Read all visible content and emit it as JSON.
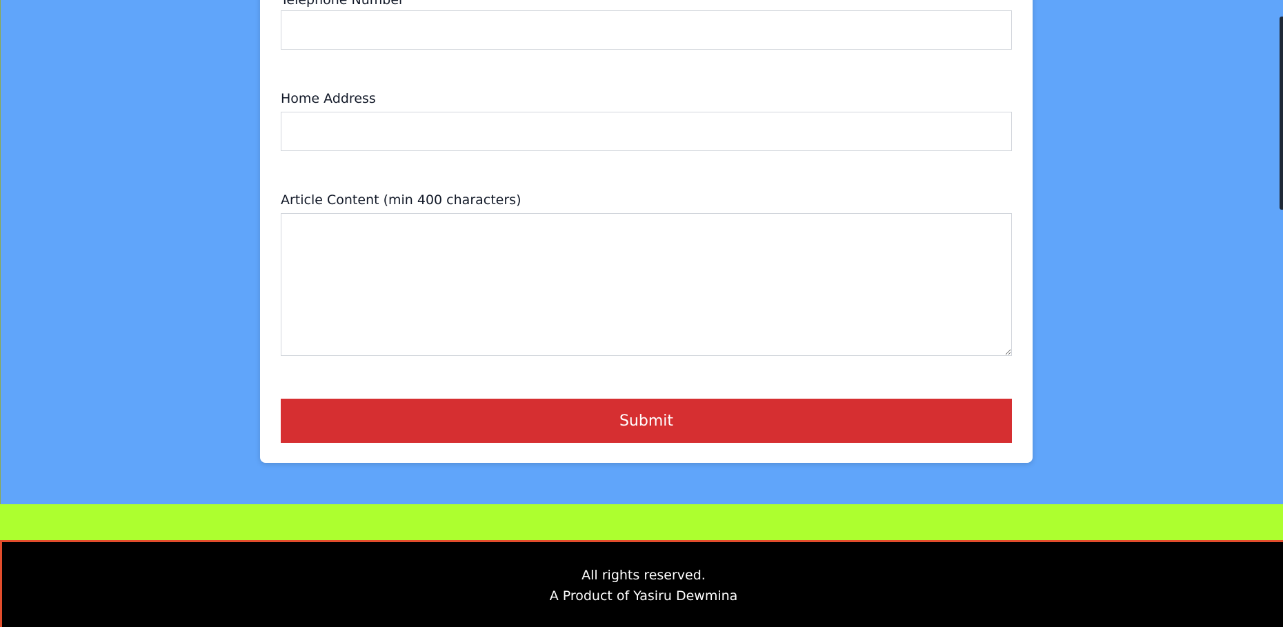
{
  "form": {
    "telephone_label": "Telephone Number",
    "home_address_label": "Home Address",
    "article_content_label": "Article Content (min 400 characters)",
    "telephone_value": "",
    "home_address_value": "",
    "article_content_value": "",
    "submit_label": "Submit"
  },
  "footer": {
    "rights": "All rights reserved.",
    "product": "A Product of Yasiru Dewmina"
  },
  "colors": {
    "page_background": "#60a5fa",
    "card_background": "#ffffff",
    "submit_button": "#d62f31",
    "lime_band": "#adff2f",
    "footer_background": "#000000",
    "footer_border": "#e24d2c"
  },
  "icons": {
    "textarea_resize_handle": "resize-handle-icon"
  }
}
